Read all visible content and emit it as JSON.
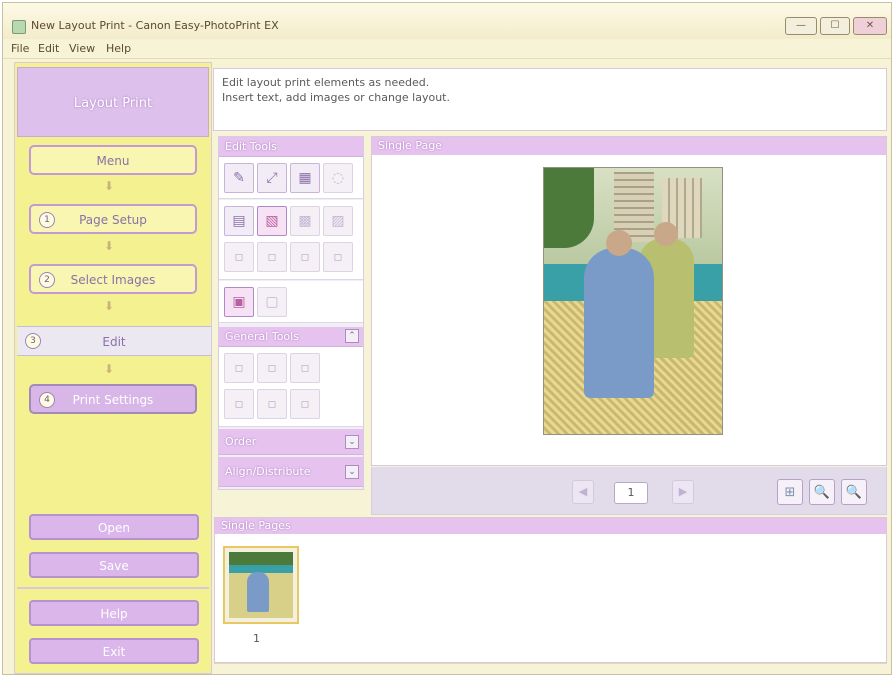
{
  "window": {
    "title": "New Layout Print - Canon Easy-PhotoPrint EX",
    "controls": [
      "—",
      "☐",
      "✕"
    ]
  },
  "menubar": {
    "items": [
      "File",
      "Edit",
      "View",
      "Help"
    ]
  },
  "sidebar": {
    "header": "Layout Print",
    "menu_label": "Menu",
    "steps": [
      {
        "num": "1",
        "label": "Page Setup"
      },
      {
        "num": "2",
        "label": "Select Images"
      },
      {
        "num": "3",
        "label": "Edit"
      },
      {
        "num": "4",
        "label": "Print Settings"
      }
    ],
    "arrow_glyph": "⬇",
    "open_label": "Open",
    "save_label": "Save",
    "help_label": "Help",
    "exit_label": "Exit"
  },
  "instructions": {
    "line1": "Edit layout print elements as needed.",
    "line2": "Insert text, add images or change layout."
  },
  "tools": {
    "edit_tools_label": "Edit Tools",
    "general_tools_label": "General Tools",
    "order_label": "Order",
    "align_label": "Align/Distribute",
    "collapse_glyph": "⌃",
    "expand_glyph": "⌄",
    "row1": [
      "✎",
      "⤢",
      "▦",
      "◌"
    ],
    "row2": [
      "▤",
      "▧",
      "▩",
      "▨"
    ],
    "row3": [
      "▫",
      "▫",
      "▫",
      "▫"
    ],
    "row4": [
      "▣",
      "▢"
    ],
    "general_row1": [
      "▫",
      "▫",
      "▫"
    ],
    "general_row2": [
      "▫",
      "▫",
      "▫"
    ]
  },
  "preview": {
    "header": "Single Page",
    "page_number": "1",
    "prev_glyph": "◀",
    "next_glyph": "▶",
    "zoom_glyphs": [
      "⊞",
      "🔍",
      "🔍"
    ]
  },
  "pages": {
    "header": "Single Pages",
    "thumb_label": "1"
  }
}
